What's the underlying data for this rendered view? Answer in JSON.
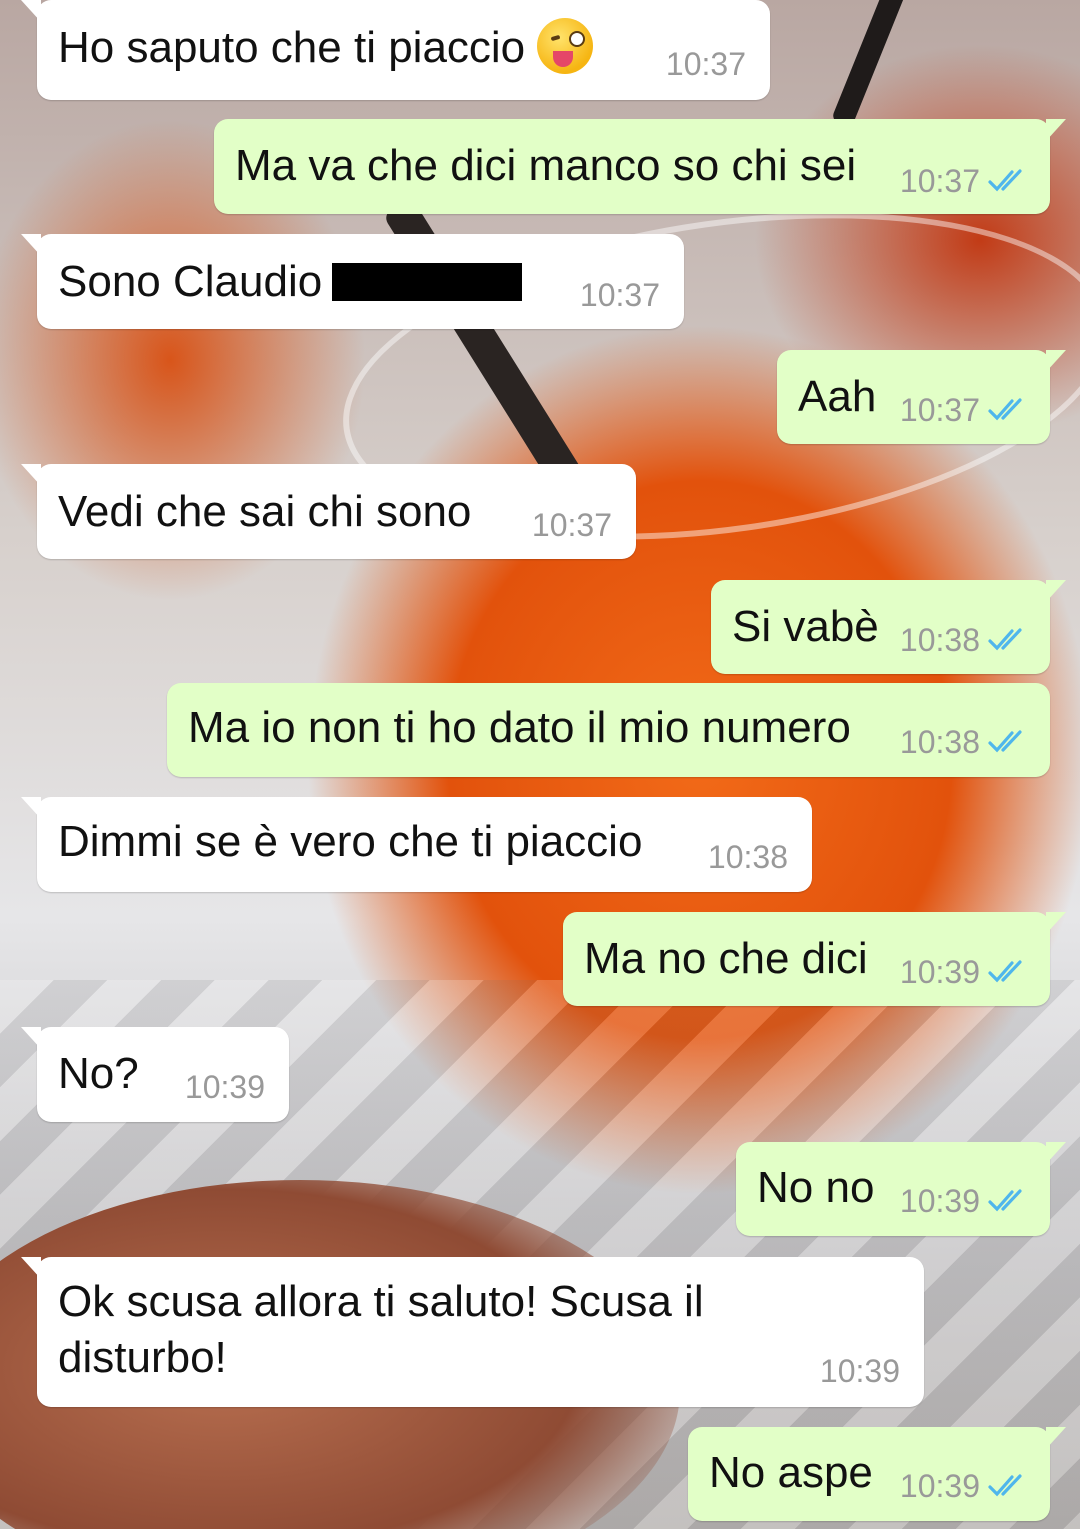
{
  "messages": [
    {
      "side": "in",
      "text": "Ho saputo che ti piaccio",
      "emoji": "winking-face-with-tongue",
      "time": "10:37"
    },
    {
      "side": "out",
      "text": "Ma va che dici manco so chi sei",
      "time": "10:37",
      "read": true
    },
    {
      "side": "in",
      "text": "Sono Claudio",
      "redacted": true,
      "time": "10:37"
    },
    {
      "side": "out",
      "text": "Aah",
      "time": "10:37",
      "read": true
    },
    {
      "side": "in",
      "text": "Vedi che sai chi sono",
      "time": "10:37"
    },
    {
      "side": "out",
      "text": "Si vabè",
      "time": "10:38",
      "read": true
    },
    {
      "side": "out",
      "text": "Ma io non ti ho dato il mio numero",
      "time": "10:38",
      "read": true
    },
    {
      "side": "in",
      "text": "Dimmi se è vero che ti piaccio",
      "time": "10:38"
    },
    {
      "side": "out",
      "text": "Ma no che dici",
      "time": "10:39",
      "read": true
    },
    {
      "side": "in",
      "text": "No?",
      "time": "10:39"
    },
    {
      "side": "out",
      "text": "No no",
      "time": "10:39",
      "read": true
    },
    {
      "side": "in",
      "text": "Ok scusa allora ti saluto! Scusa il disturbo!",
      "time": "10:39"
    },
    {
      "side": "out",
      "text": "No aspe",
      "time": "10:39",
      "read": true
    }
  ],
  "colors": {
    "incoming_bubble": "#ffffff",
    "outgoing_bubble": "#e2ffc7",
    "timestamp": "#999999",
    "read_ticks": "#4fb6ec"
  },
  "icons": {
    "read_receipt": "double-check-icon",
    "emoji": "winking-face-with-tongue-emoji"
  }
}
